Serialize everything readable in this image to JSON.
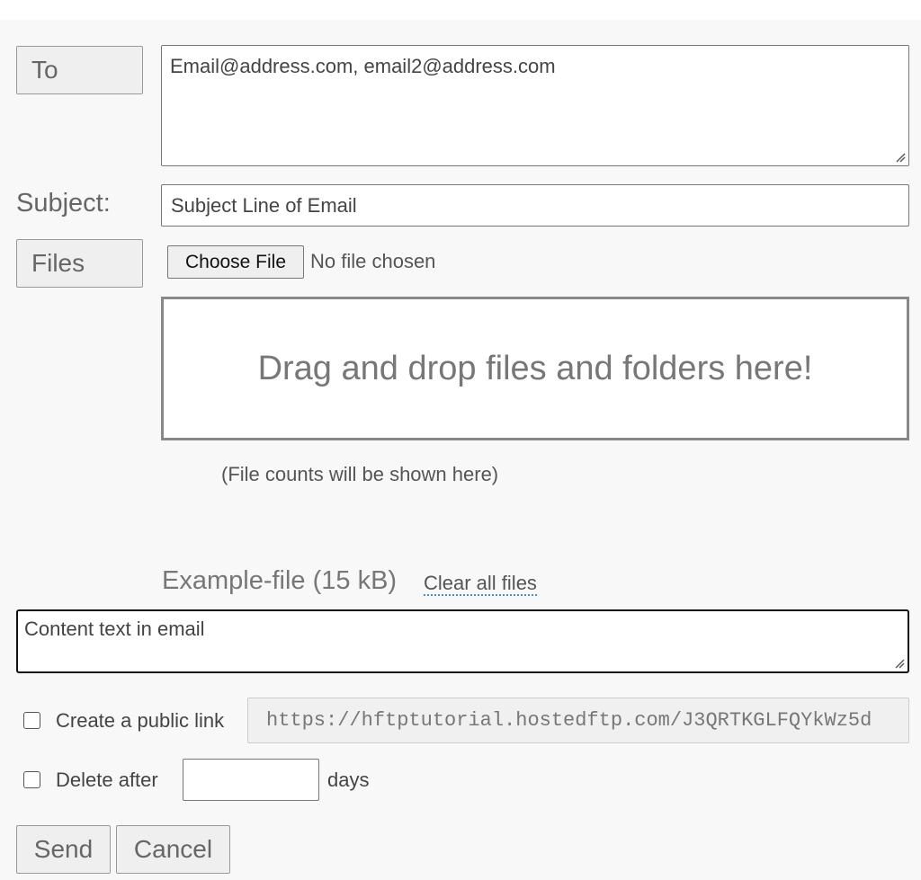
{
  "recipients": {
    "button_label": "To",
    "value": "Email@address.com, email2@address.com"
  },
  "subject": {
    "label": "Subject:",
    "value": "Subject Line of Email"
  },
  "files": {
    "button_label": "Files",
    "choose_button_label": "Choose File",
    "no_file_text": "No file chosen",
    "dropzone_text": "Drag and drop files and folders here!",
    "file_counts_text": "(File counts will be shown here)",
    "example_file": "Example-file (15 kB)",
    "clear_all_label": "Clear all files"
  },
  "content": {
    "value": "Content text in email"
  },
  "options": {
    "public_link_label": "Create a public link",
    "public_link_checked": false,
    "public_link_url": "https://hftptutorial.hostedftp.com/J3QRTKGLFQYkWz5d",
    "delete_after_label": "Delete after",
    "delete_after_checked": false,
    "delete_after_value": "",
    "days_label": "days"
  },
  "actions": {
    "send_label": "Send",
    "cancel_label": "Cancel"
  }
}
